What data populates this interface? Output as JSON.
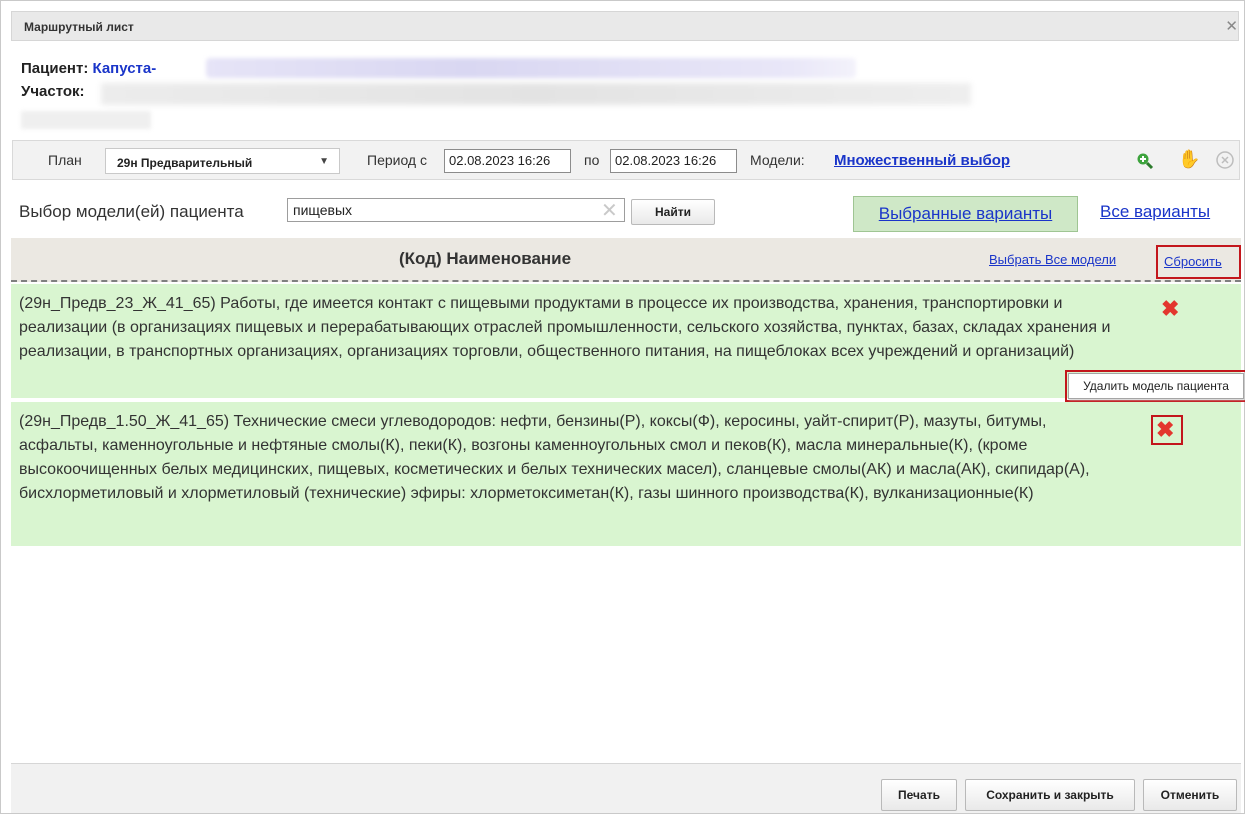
{
  "window": {
    "title": "Маршрутный лист"
  },
  "patient": {
    "label": "Пациент:",
    "name": "Капуста-",
    "district_label": "Участок:"
  },
  "toolbar": {
    "plan_label": "План",
    "plan_value": "29н Предварительный",
    "period_label": "Период с",
    "date_from": "02.08.2023 16:26",
    "to_label": "по",
    "date_to": "02.08.2023 16:26",
    "models_label": "Модели:",
    "models_link": "Множественный выбор"
  },
  "search": {
    "label": "Выбор модели(ей) пациента",
    "value": "пищевых",
    "button": "Найти"
  },
  "tabs": {
    "selected": "Выбранные варианты",
    "all": "Все варианты"
  },
  "table": {
    "header": "(Код) Наименование",
    "select_all": "Выбрать Все модели",
    "reset": "Сбросить",
    "rows": [
      {
        "text": "(29н_Предв_23_Ж_41_65) Работы, где имеется контакт с пищевыми продуктами в процессе их производства, хранения, транспортировки и реализации (в организациях пищевых и перерабатывающих отраслей промышленности, сельского хозяйства, пунктах, базах, складах хранения и реализации, в транспортных организациях, организациях торговли, общественного питания, на пищеблоках всех учреждений и организаций)"
      },
      {
        "text": "(29н_Предв_1.50_Ж_41_65) Технические смеси углеводородов: нефти, бензины(Р), коксы(Ф), керосины, уайт-спирит(Р), мазуты, битумы, асфальты, каменноугольные и нефтяные смолы(К), пеки(К), возгоны каменноугольных смол и пеков(К), масла минеральные(К), (кроме высокоочищенных белых медицинских, пищевых, косметических и белых технических масел), сланцевые смолы(АК) и масла(АК), скипидар(А), бисхлорметиловый и хлорметиловый (технические) эфиры: хлорметоксиметан(К), газы шинного производства(К), вулканизационные(К)"
      }
    ],
    "tooltip": "Удалить модель пациента"
  },
  "footer": {
    "print": "Печать",
    "save_close": "Сохранить и закрыть",
    "cancel": "Отменить"
  },
  "icons": {
    "close": "close-icon",
    "zoom": "zoom-in-icon",
    "hand": "hand-icon",
    "cancel": "cancel-circle-icon",
    "clear": "clear-x-icon",
    "delete": "delete-x-icon"
  },
  "colors": {
    "accent": "#1a35c9",
    "row_bg": "#d9f5d0",
    "highlight": "#c3161c",
    "delete": "#e3362e"
  }
}
